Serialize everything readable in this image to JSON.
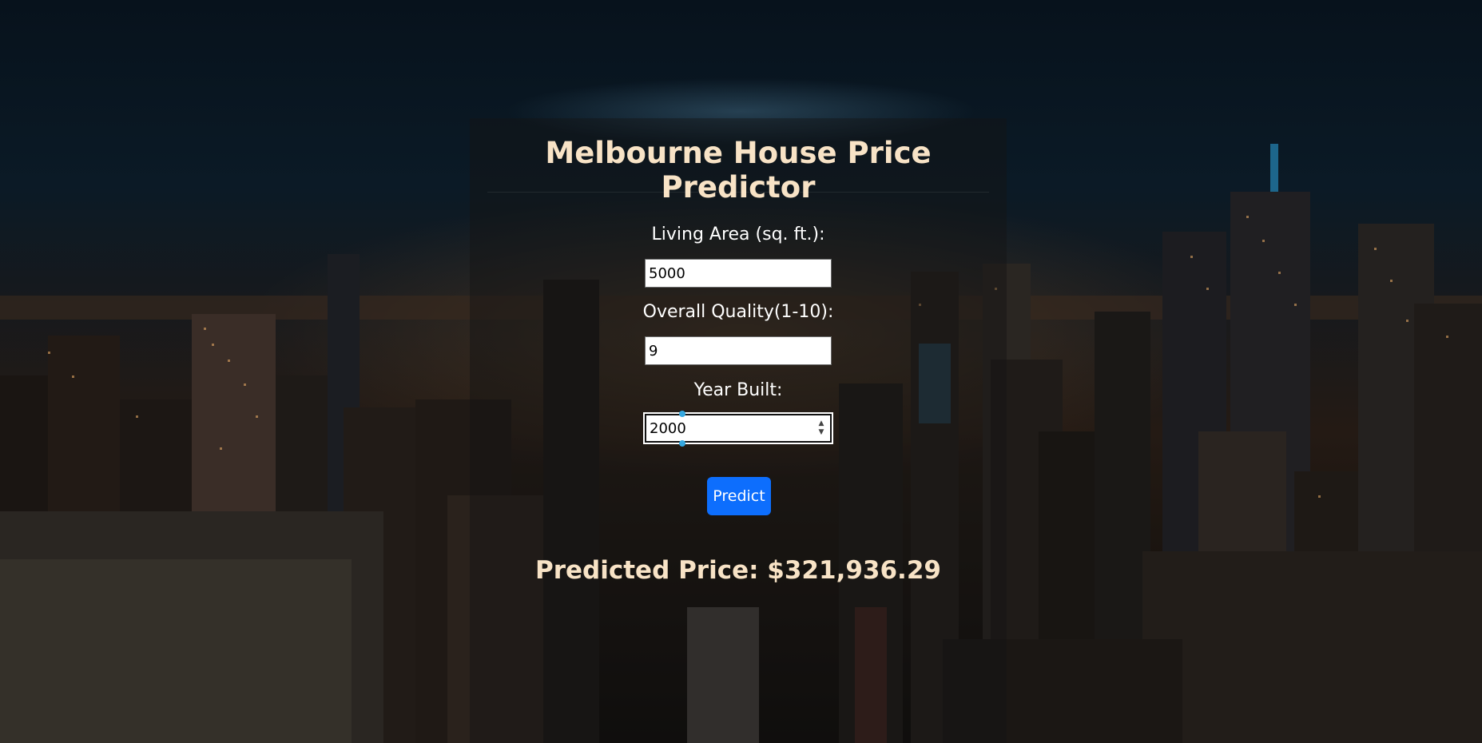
{
  "app": {
    "title": "Melbourne House Price Predictor"
  },
  "form": {
    "living_area": {
      "label": "Living Area (sq. ft.):",
      "value": "5000"
    },
    "overall_quality": {
      "label": "Overall Quality(1-10):",
      "value": "9"
    },
    "year_built": {
      "label": "Year Built:",
      "value": "2000"
    },
    "submit_label": "Predict"
  },
  "result": {
    "text": "Predicted Price: $321,936.29"
  },
  "colors": {
    "title": "#f8e3c6",
    "button": "#0d6efd",
    "label": "#ffffff"
  }
}
